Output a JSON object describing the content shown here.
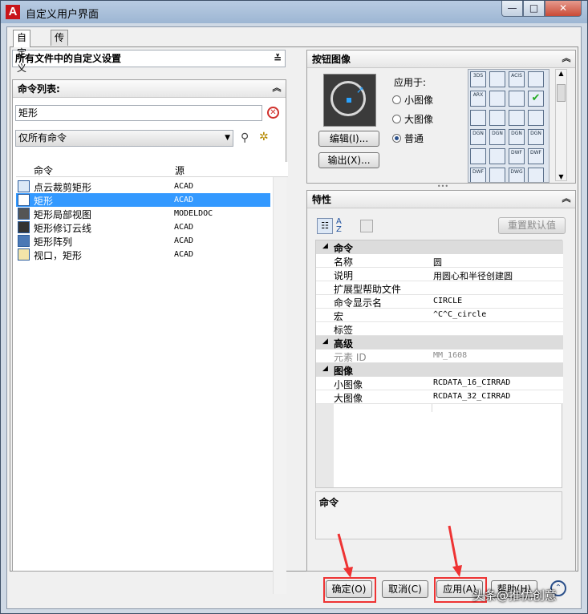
{
  "window": {
    "title": "自定义用户界面",
    "app_icon_letter": "A",
    "controls": {
      "minimize": "—",
      "maximize": "□",
      "close": "✕"
    }
  },
  "tabs": [
    {
      "label": "自定义",
      "active": true
    },
    {
      "label": "传输",
      "active": false
    }
  ],
  "customizations": {
    "selector_value": "所有文件中的自定义设置"
  },
  "command_list": {
    "header": "命令列表:",
    "search_value": "矩形",
    "filter_value": "仅所有命令",
    "columns": {
      "command": "命令",
      "source": "源"
    },
    "rows": [
      {
        "name": "点云裁剪矩形",
        "source": "ACAD",
        "selected": false
      },
      {
        "name": "矩形",
        "source": "ACAD",
        "selected": true
      },
      {
        "name": "矩形局部视图",
        "source": "MODELDOC",
        "selected": false
      },
      {
        "name": "矩形修订云线",
        "source": "ACAD",
        "selected": false
      },
      {
        "name": "矩形阵列",
        "source": "ACAD",
        "selected": false
      },
      {
        "name": "视口，矩形",
        "source": "ACAD",
        "selected": false
      }
    ]
  },
  "button_image": {
    "header": "按钮图像",
    "apply_to_label": "应用于:",
    "options": [
      {
        "label": "小图像",
        "checked": false
      },
      {
        "label": "大图像",
        "checked": false
      },
      {
        "label": "普通",
        "checked": true
      }
    ],
    "edit_button": "编辑(I)...",
    "export_button": "输出(X)...",
    "icon_grid": [
      [
        "3DS",
        "",
        "ACIS",
        ""
      ],
      [
        "ARX",
        "",
        "",
        "✔"
      ],
      [
        "",
        "",
        "",
        ""
      ],
      [
        "DGN",
        "DGN",
        "DGN",
        "DGN"
      ],
      [
        "",
        "",
        "DWF",
        "DWF"
      ],
      [
        "DWF",
        "",
        "DWG",
        ""
      ]
    ]
  },
  "properties": {
    "header": "特性",
    "reset_button": "重置默认值",
    "categories": [
      {
        "name": "命令",
        "rows": [
          {
            "key": "名称",
            "value": "圆",
            "mono": false,
            "grey": false
          },
          {
            "key": "说明",
            "value": "用圆心和半径创建圆",
            "mono": false,
            "grey": false
          },
          {
            "key": "扩展型帮助文件",
            "value": "",
            "mono": false,
            "grey": false
          },
          {
            "key": "命令显示名",
            "value": "CIRCLE",
            "mono": true,
            "grey": false
          },
          {
            "key": "宏",
            "value": "^C^C_circle",
            "mono": true,
            "grey": false
          },
          {
            "key": "标签",
            "value": "",
            "mono": false,
            "grey": false
          }
        ]
      },
      {
        "name": "高级",
        "rows": [
          {
            "key": "元素 ID",
            "value": "MM_1608",
            "mono": true,
            "grey": true
          }
        ]
      },
      {
        "name": "图像",
        "rows": [
          {
            "key": "小图像",
            "value": "RCDATA_16_CIRRAD",
            "mono": true,
            "grey": false
          },
          {
            "key": "大图像",
            "value": "RCDATA_32_CIRRAD",
            "mono": true,
            "grey": false
          }
        ]
      }
    ],
    "description_title": "命令"
  },
  "footer": {
    "ok": "确定(O)",
    "cancel": "取消(C)",
    "apply": "应用(A)",
    "help": "帮助(H)"
  },
  "watermark": "头条@推优创意",
  "colors": {
    "selection": "#3399ff",
    "highlight_box": "#ee3333"
  }
}
